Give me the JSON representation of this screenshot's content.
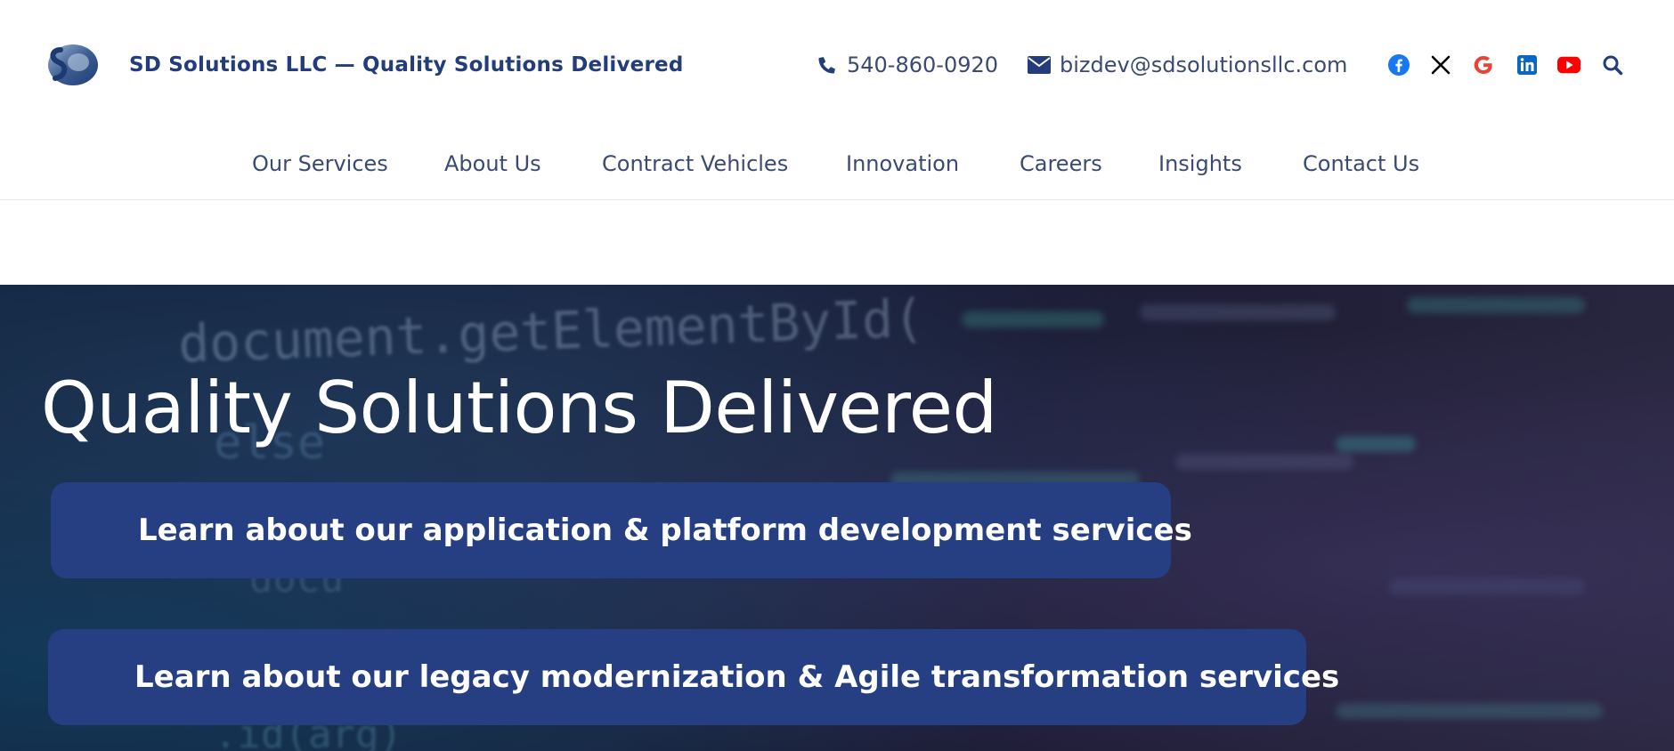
{
  "header": {
    "logo_alt": "SD",
    "site_title": "SD Solutions LLC — Quality Solutions Delivered",
    "phone": "540-860-0920",
    "email": "bizdev@sdsolutionsllc.com"
  },
  "social": [
    {
      "name": "facebook-icon",
      "color": "#1877f2"
    },
    {
      "name": "x-icon",
      "color": "#000000"
    },
    {
      "name": "google-icon",
      "color": "#ea4335"
    },
    {
      "name": "linkedin-icon",
      "color": "#0a66c2"
    },
    {
      "name": "youtube-icon",
      "color": "#ff0000"
    },
    {
      "name": "search-icon",
      "color": "#223c7c"
    }
  ],
  "nav": {
    "items": [
      {
        "label": "Our Services"
      },
      {
        "label": "About Us"
      },
      {
        "label": "Contract Vehicles"
      },
      {
        "label": "Innovation"
      },
      {
        "label": "Careers"
      },
      {
        "label": "Insights"
      },
      {
        "label": "Contact Us"
      }
    ]
  },
  "hero": {
    "title": "Quality Solutions Delivered",
    "cta_primary": "Learn about our application & platform development services",
    "cta_secondary": "Learn about our legacy modernization & Agile transformation services",
    "background_code": {
      "line1": "document.getElementById(",
      "line2": "else",
      "line3": "docu",
      "line4": ".id(arg)"
    }
  },
  "colors": {
    "brand": "#223c7c",
    "cta_bg": "#253f82",
    "text": "#3a4a73"
  }
}
